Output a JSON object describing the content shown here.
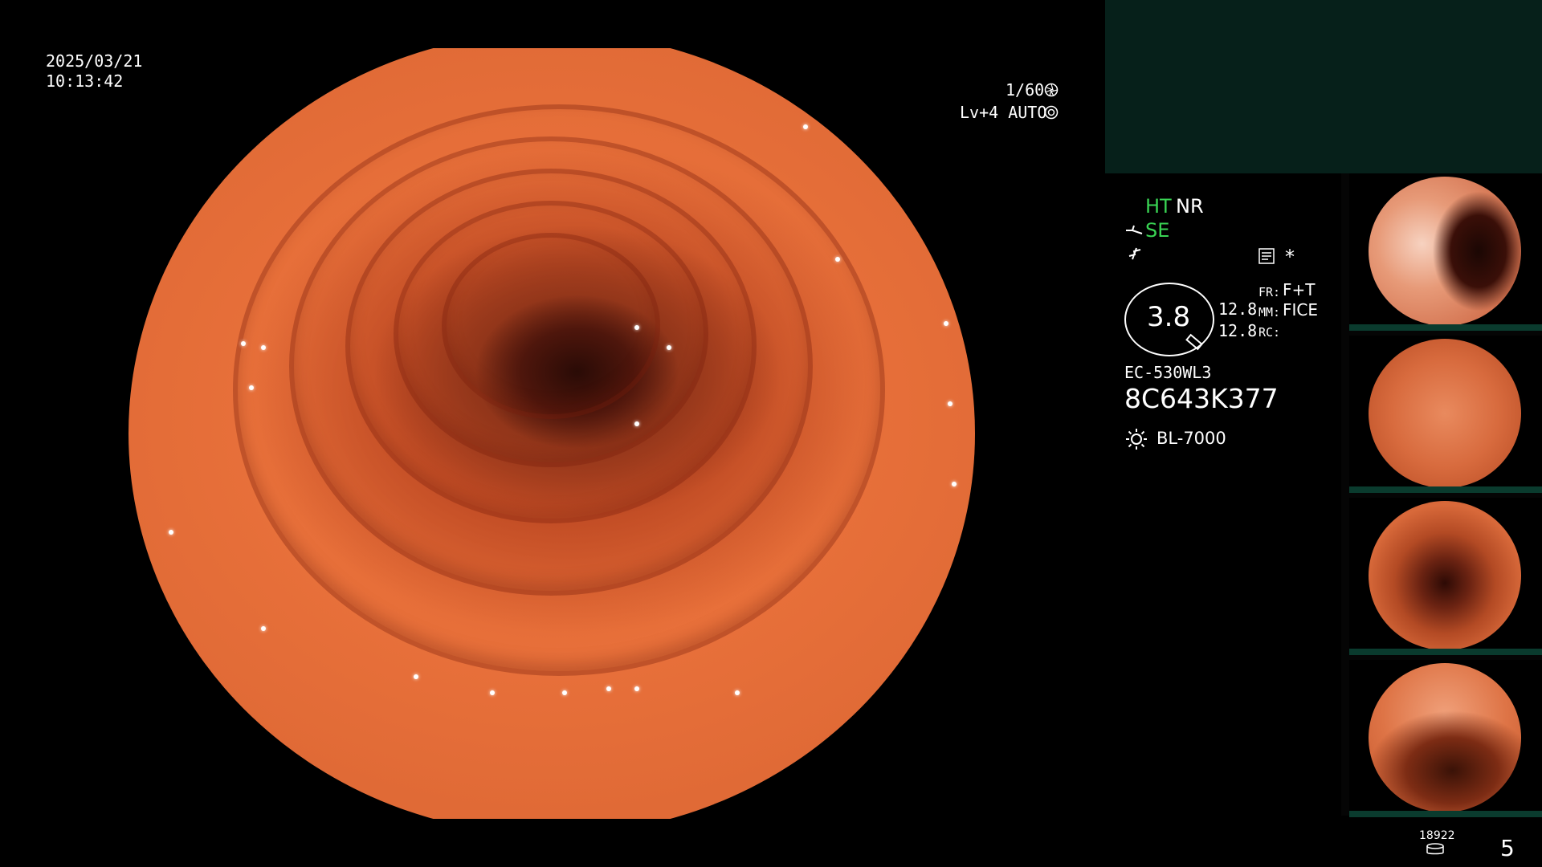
{
  "overlay": {
    "date": "2025/03/21",
    "time": "10:13:42",
    "shutter": "1/60",
    "level": "Lv+4 AUTO"
  },
  "settings": {
    "ht": "HT",
    "nr": "NR",
    "se": "SE",
    "zoom": "3.8",
    "value_a": "12.8",
    "value_b": "12.8",
    "fr_label": "FR:",
    "fr_value": "F+T",
    "mm_label": "MM:",
    "mm_value": "FICE",
    "rc_label": "RC:",
    "asterisk": "*",
    "scope_model": "EC-530WL3",
    "serial": "8C643K377",
    "light_source": "BL-7000"
  },
  "thumbnails": [
    {
      "name": "capture-1"
    },
    {
      "name": "capture-2"
    },
    {
      "name": "capture-3"
    },
    {
      "name": "capture-4"
    }
  ],
  "footer": {
    "storage_count": "18922",
    "page_number": "5"
  },
  "colors": {
    "green_label": "#39d353",
    "panel_bg": "#06201a",
    "tissue": "#e06a36"
  },
  "icons": [
    "shutter-icon",
    "auto-iris-icon",
    "tip-bend-icon",
    "structure-enhance-icon",
    "memo-icon",
    "lightbulb-icon",
    "database-icon"
  ]
}
